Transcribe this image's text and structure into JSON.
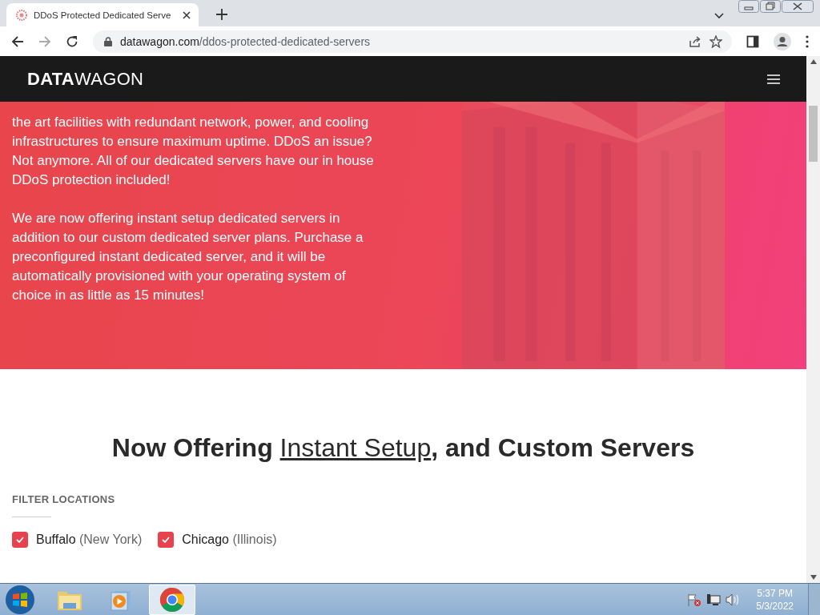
{
  "browser": {
    "tab_title": "DDoS Protected Dedicated Serve",
    "url_host": "datawagon.com",
    "url_path": "/ddos-protected-dedicated-servers"
  },
  "site_header": {
    "logo_bold": "DATA",
    "logo_light": "WAGON"
  },
  "hero": {
    "paragraphs": [
      "the art facilities with redundant network, power, and cooling infrastructures to ensure maximum uptime. DDoS an issue? Not anymore. All of our dedicated servers have our in house DDoS protection included!",
      "We are now offering instant setup dedicated servers in addition to our custom dedicated server plans. Purchase a preconfigured instant dedicated server, and it will be automatically provisioned with your operating system of choice in as little as 15 minutes!"
    ],
    "kind": "picture"
  },
  "offer": {
    "heading_before": "Now Offering ",
    "heading_link": "Instant Setup",
    "heading_after": ", and Custom Servers",
    "filter_label": "FILTER LOCATIONS",
    "locations": [
      {
        "city": "Buffalo",
        "region": "(New York)",
        "checked": true
      },
      {
        "city": "Chicago",
        "region": "(Illinois)",
        "checked": true
      }
    ]
  },
  "taskbar": {
    "time": "5:37 PM",
    "date": "5/3/2022"
  }
}
